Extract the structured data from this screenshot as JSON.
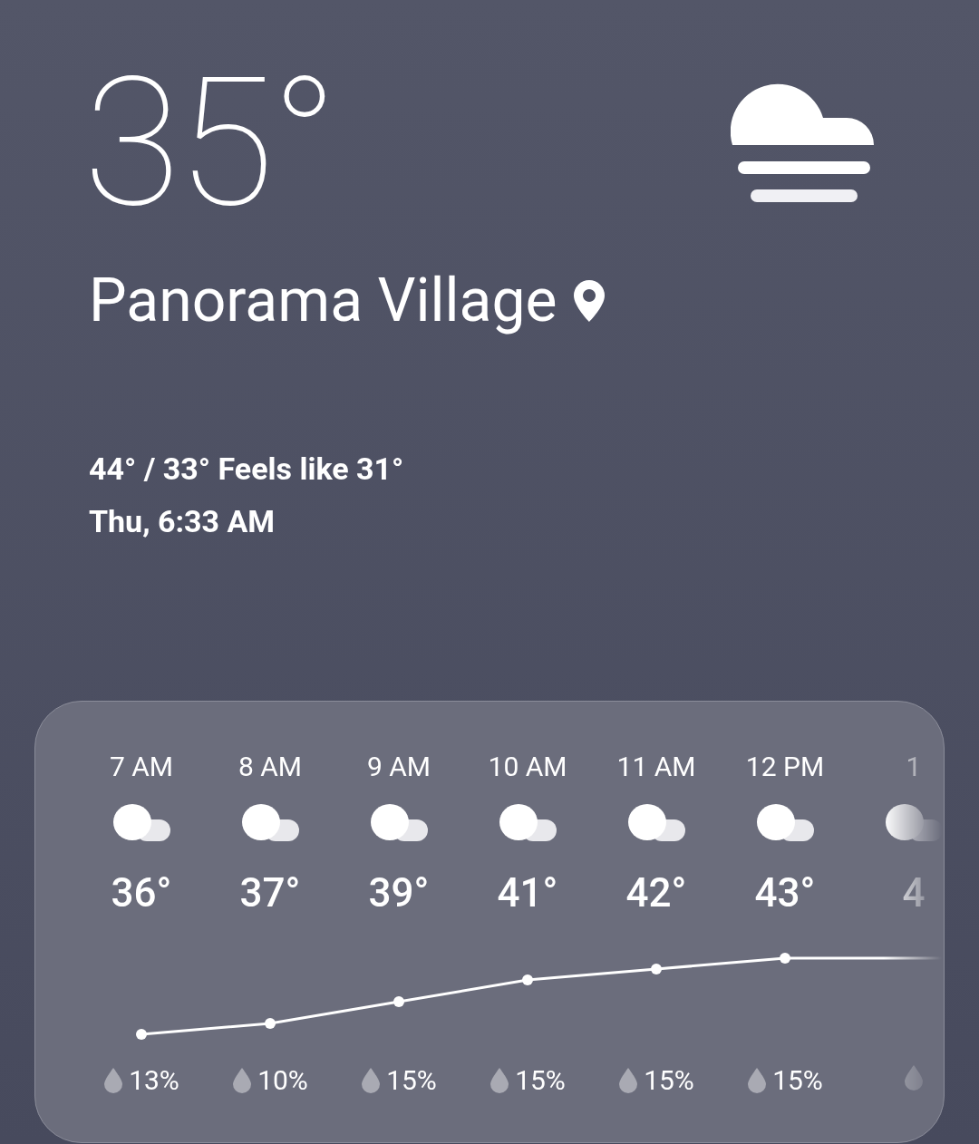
{
  "current": {
    "temperature": "35°",
    "location": "Panorama Village",
    "high_low_feels": "44° / 33° Feels like 31°",
    "datetime": "Thu, 6:33 AM"
  },
  "hourly": [
    {
      "time": "7 AM",
      "temperature": "36°",
      "precipitation": "13%"
    },
    {
      "time": "8 AM",
      "temperature": "37°",
      "precipitation": "10%"
    },
    {
      "time": "9 AM",
      "temperature": "39°",
      "precipitation": "15%"
    },
    {
      "time": "10 AM",
      "temperature": "41°",
      "precipitation": "15%"
    },
    {
      "time": "11 AM",
      "temperature": "42°",
      "precipitation": "15%"
    },
    {
      "time": "12 PM",
      "temperature": "43°",
      "precipitation": "15%"
    },
    {
      "time": "1",
      "temperature": "4"
    }
  ]
}
